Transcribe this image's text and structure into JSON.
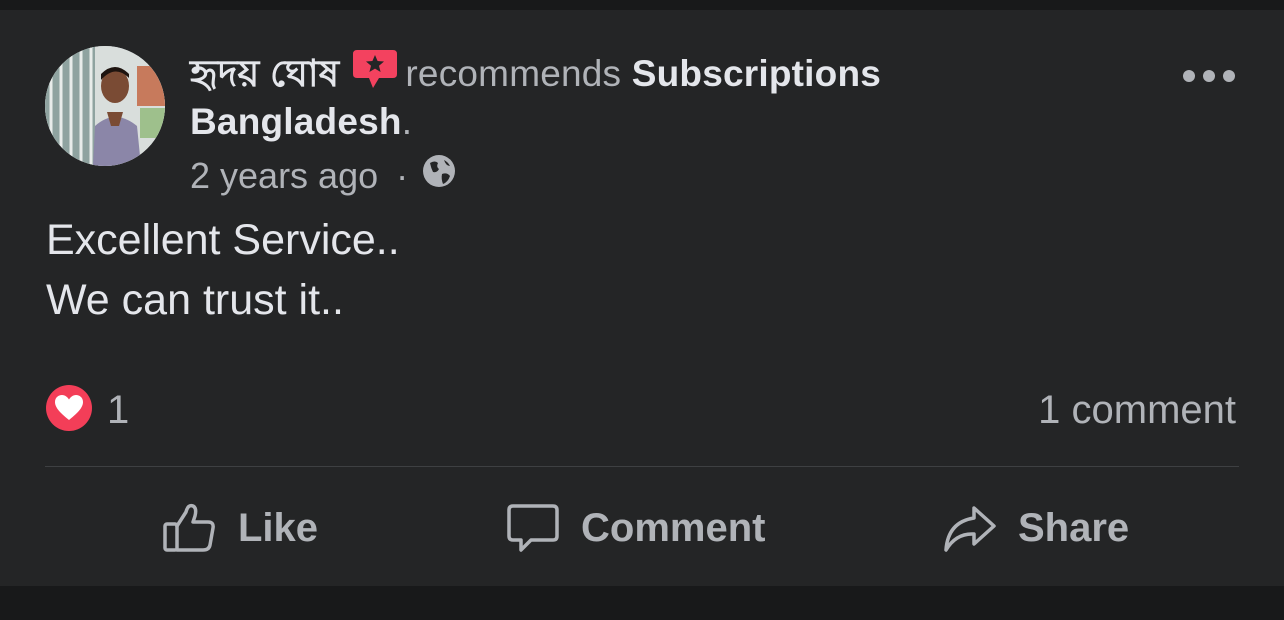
{
  "post": {
    "author": "হৃদয় ঘোষ",
    "recommends_text": "recommends",
    "page_name_part1": "Subscriptions",
    "page_name_part2": "Bangladesh",
    "period": ".",
    "timestamp": "2 years ago",
    "separator": "·",
    "privacy_icon": "globe-icon",
    "body_line1": "Excellent Service..",
    "body_line2": "We can trust it..",
    "reaction_icon": "heart-icon",
    "reaction_count": "1",
    "comment_count_text": "1 comment"
  },
  "actions": {
    "like_label": "Like",
    "comment_label": "Comment",
    "share_label": "Share"
  },
  "colors": {
    "background": "#242526",
    "page_background": "#18191a",
    "text_primary": "#e4e6eb",
    "text_secondary": "#b0b3b8",
    "recommend_badge": "#f3425f",
    "heart_reaction": "#f33e58"
  }
}
